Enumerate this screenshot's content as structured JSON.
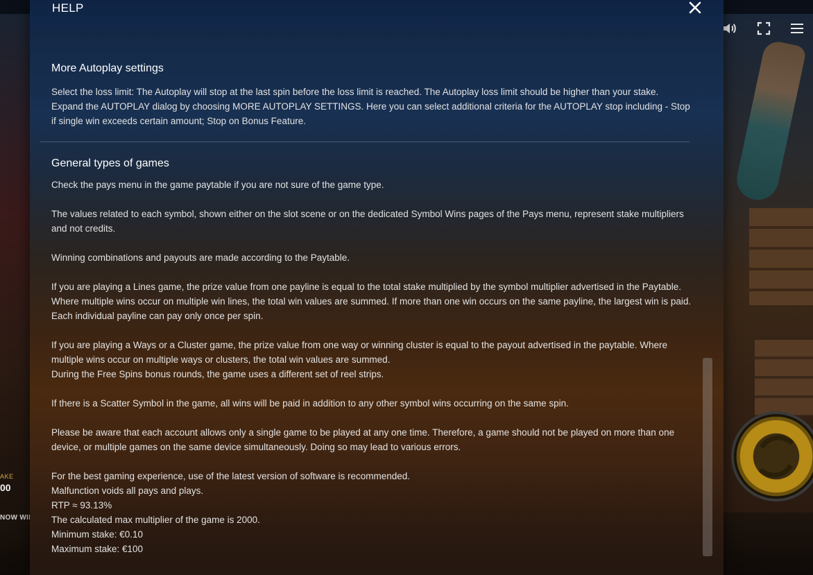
{
  "game": {
    "stake_label": "AKE",
    "stake_value": "00",
    "now_win_label": "NOW WIL"
  },
  "header": {
    "title": "HELP",
    "close_icon": "close-icon"
  },
  "toolbar_icons": [
    "volume-icon",
    "fullscreen-icon",
    "menu-icon"
  ],
  "sections": {
    "autoplay": {
      "heading": "More Autoplay settings",
      "line1": "Select the loss limit: The Autoplay will stop at the last spin before the loss limit is reached. The Autoplay loss limit should be higher than your stake.",
      "line2": "Expand the AUTOPLAY dialog by choosing MORE AUTOPLAY SETTINGS. Here you can select additional criteria for the AUTOPLAY stop including - Stop if single win exceeds certain amount; Stop on Bonus Feature."
    },
    "general": {
      "heading": "General types of games",
      "p1": "Check the pays menu in the game paytable if you are not sure of the game type.",
      "p2": "The values related to each symbol, shown either on the slot scene or on the dedicated Symbol Wins pages of the Pays menu, represent stake multipliers and not credits.",
      "p3": "Winning combinations and payouts are made according to the Paytable.",
      "p4": "If you are playing a Lines game, the prize value from one payline is equal to the total stake multiplied by the symbol multiplier advertised in the Paytable. Where multiple wins occur on multiple win lines, the total win values are summed. If more than one win occurs on the same payline, the largest win is paid. Each individual payline can pay only once per spin.",
      "p5a": "If you are playing a Ways or a Cluster game, the prize value from one way or winning cluster is equal to the payout advertised in the paytable. Where multiple wins occur on multiple ways or clusters, the total win values are summed.",
      "p5b": "During the Free Spins bonus rounds, the game uses a different set of reel strips.",
      "p6": "If there is a Scatter Symbol in the game, all wins will be paid in addition to any other symbol wins occurring on the same spin.",
      "p7": "Please be aware that each account allows only a single game to be played at any one time. Therefore, a game should not be played on more than one device, or multiple games on the same device simultaneously. Doing so may lead to various errors.",
      "p8": "For the best gaming experience, use of the latest version of software is recommended.",
      "p9": "Malfunction voids all pays and plays.",
      "p10": "RTP ≈ 93.13%",
      "p11": "The calculated max multiplier of the game is 2000.",
      "p12": "Minimum stake: €0.10",
      "p13": "Maximum stake: €100"
    }
  }
}
